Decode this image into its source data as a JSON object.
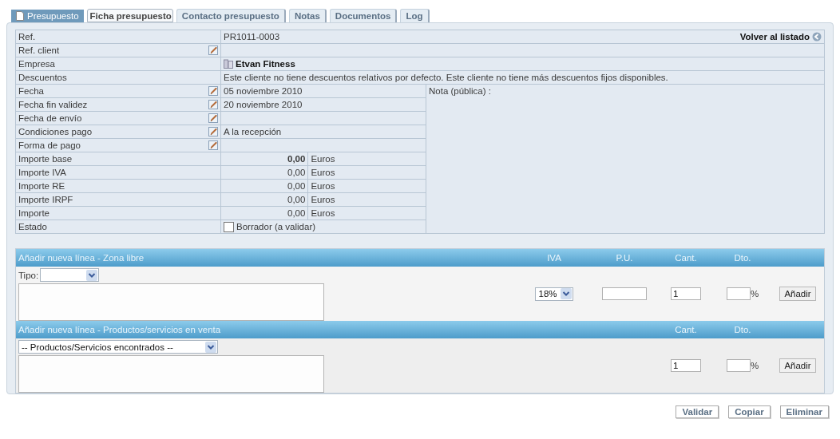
{
  "tabs": [
    {
      "label": "Presupuesto",
      "kind": "module",
      "selected": false
    },
    {
      "label": "Ficha presupuesto",
      "kind": "tab",
      "selected": true
    },
    {
      "label": "Contacto presupuesto",
      "kind": "tab",
      "selected": false
    },
    {
      "label": "Notas",
      "kind": "tab",
      "selected": false
    },
    {
      "label": "Documentos",
      "kind": "tab",
      "selected": false
    },
    {
      "label": "Log",
      "kind": "tab",
      "selected": false
    }
  ],
  "back_link": "Volver al listado",
  "wide_rows": [
    {
      "label": "Ref.",
      "value": "PR1011-0003",
      "kind": "text",
      "editable": false
    },
    {
      "label": "Ref. client",
      "kind": "text",
      "editable": true
    },
    {
      "label": "Empresa",
      "value": "Etvan Fitness",
      "kind": "company",
      "editable": false
    },
    {
      "label": "Descuentos",
      "value": "Este cliente no tiene descuentos relativos por defecto. Este cliente no tiene más descuentos fijos disponibles.",
      "kind": "text",
      "editable": false
    }
  ],
  "note_label": "Nota (pública) :",
  "rows": [
    {
      "label": "Fecha",
      "value": "05 noviembre 2010",
      "kind": "text",
      "editable": true
    },
    {
      "label": "Fecha fin validez",
      "value": "20 noviembre 2010",
      "kind": "text",
      "editable": true
    },
    {
      "label": "Fecha de envío",
      "kind": "text",
      "editable": true
    },
    {
      "label": "Condiciones pago",
      "value": "A la recepción",
      "kind": "text",
      "editable": true
    },
    {
      "label": "Forma de pago",
      "kind": "text",
      "editable": true
    },
    {
      "label": "Importe base",
      "value": "0,00",
      "unit": "Euros",
      "kind": "amount",
      "emphasis": true,
      "editable": false
    },
    {
      "label": "Importe IVA",
      "value": "0,00",
      "unit": "Euros",
      "kind": "amount",
      "emphasis": false,
      "editable": false
    },
    {
      "label": "Importe RE",
      "value": "0,00",
      "unit": "Euros",
      "kind": "amount",
      "emphasis": false,
      "editable": false
    },
    {
      "label": "Importe IRPF",
      "value": "0,00",
      "unit": "Euros",
      "kind": "amount",
      "emphasis": false,
      "editable": false
    },
    {
      "label": "Importe",
      "value": "0,00",
      "unit": "Euros",
      "kind": "amount",
      "emphasis": false,
      "editable": false
    },
    {
      "label": "Estado",
      "value": "Borrador (a validar)",
      "kind": "status",
      "checked": false,
      "editable": false
    }
  ],
  "free_line": {
    "title": "Añadir nueva línea - Zona libre",
    "headers": [
      "IVA",
      "P.U.",
      "Cant.",
      "Dto."
    ],
    "type_label": "Tipo:",
    "vat": "18%",
    "quantity": "1",
    "percent_sign": "%",
    "button": "Añadir"
  },
  "product_line": {
    "title": "Añadir nueva línea - Productos/servicios en venta",
    "headers": [
      "Cant.",
      "Dto."
    ],
    "product_select": "-- Productos/Servicios encontrados --",
    "quantity": "1",
    "percent_sign": "%",
    "button": "Añadir"
  },
  "actions": [
    "Validar",
    "Copiar",
    "Eliminar"
  ]
}
